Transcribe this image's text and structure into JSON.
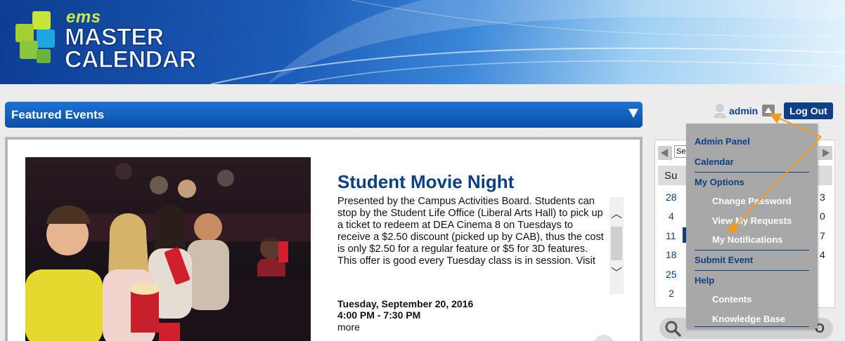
{
  "banner": {
    "logo_small": "ems",
    "logo_line1": "MASTER",
    "logo_line2": "CALENDAR"
  },
  "featured": {
    "title": "Featured Events",
    "event": {
      "title": "Student Movie Night",
      "description": "Presented by the Campus Activities Board. Students can stop by the Student Life Office (Liberal Arts Hall) to pick up a ticket to redeem at DEA Cinema 8 on Tuesdays to receive a $2.50 discount (picked up by CAB), thus the cost is only $2.50 for a regular feature or $5 for 3D features. This offer is good every Tuesday class is in session. Visit",
      "date": "Tuesday, September 20, 2016",
      "time": "4:00 PM - 7:30 PM",
      "more": "more"
    }
  },
  "user": {
    "name": "admin",
    "logout": "Log Out"
  },
  "calendar": {
    "select_value": "Se",
    "dow_first": "Su",
    "week_starts": [
      "28",
      "4",
      "11",
      "18",
      "25",
      "2"
    ],
    "right_edge": [
      "3",
      "0",
      "7",
      "4"
    ]
  },
  "search": {
    "right_glyph": "O"
  },
  "menu": {
    "admin_panel": "Admin Panel",
    "calendar": "Calendar",
    "my_options": "My Options",
    "change_password": "Change Password",
    "view_my_requests": "View My Requests",
    "my_notifications": "My Notifications",
    "submit_event": "Submit Event",
    "help": "Help",
    "contents": "Contents",
    "knowledge_base": "Knowledge Base"
  },
  "colors": {
    "brand_blue": "#0c3f86",
    "header_blue": "#0b4ea7",
    "menu_gray": "#a8a8a8",
    "annotation_orange": "#f39a1d"
  }
}
